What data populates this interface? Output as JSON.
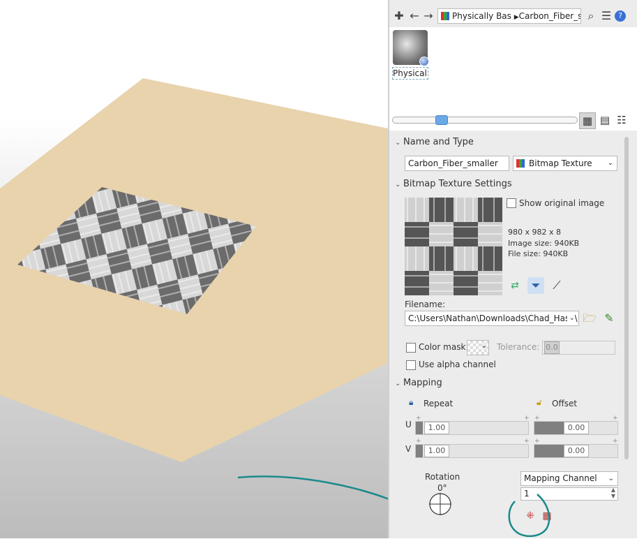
{
  "breadcrumb": {
    "part1": "Physically Bas",
    "part2": "Carbon_Fiber_smal"
  },
  "thumbnail": {
    "label": "Physical..."
  },
  "sections": {
    "name_type": "Name and Type",
    "bitmap": "Bitmap Texture Settings",
    "mapping": "Mapping"
  },
  "name_type": {
    "name_value": "Carbon_Fiber_smaller",
    "type_value": "Bitmap Texture"
  },
  "bitmap": {
    "show_original": "Show original image",
    "dims": "980 x 982 x 8",
    "image_size": "Image size: 940KB",
    "file_size": "File size: 940KB",
    "filename_label": "Filename:",
    "filename_value": "C:\\Users\\Nathan\\Downloads\\Chad_Hase\\",
    "color_mask": "Color mask",
    "tolerance_label": "Tolerance:",
    "tolerance_value": "0.0",
    "use_alpha": "Use alpha channel"
  },
  "mapping": {
    "repeat_label": "Repeat",
    "offset_label": "Offset",
    "u_label": "U",
    "v_label": "V",
    "repeat_u": "1.00",
    "repeat_v": "1.00",
    "offset_u": "0.00",
    "offset_v": "0.00",
    "rotation_label": "Rotation",
    "rotation_value": "0°",
    "channel_dropdown": "Mapping Channel",
    "channel_value": "1"
  },
  "colors": {
    "accent": "#6aa9e6",
    "annotation": "#1a8a8a",
    "plane": "#e8d3ad"
  }
}
